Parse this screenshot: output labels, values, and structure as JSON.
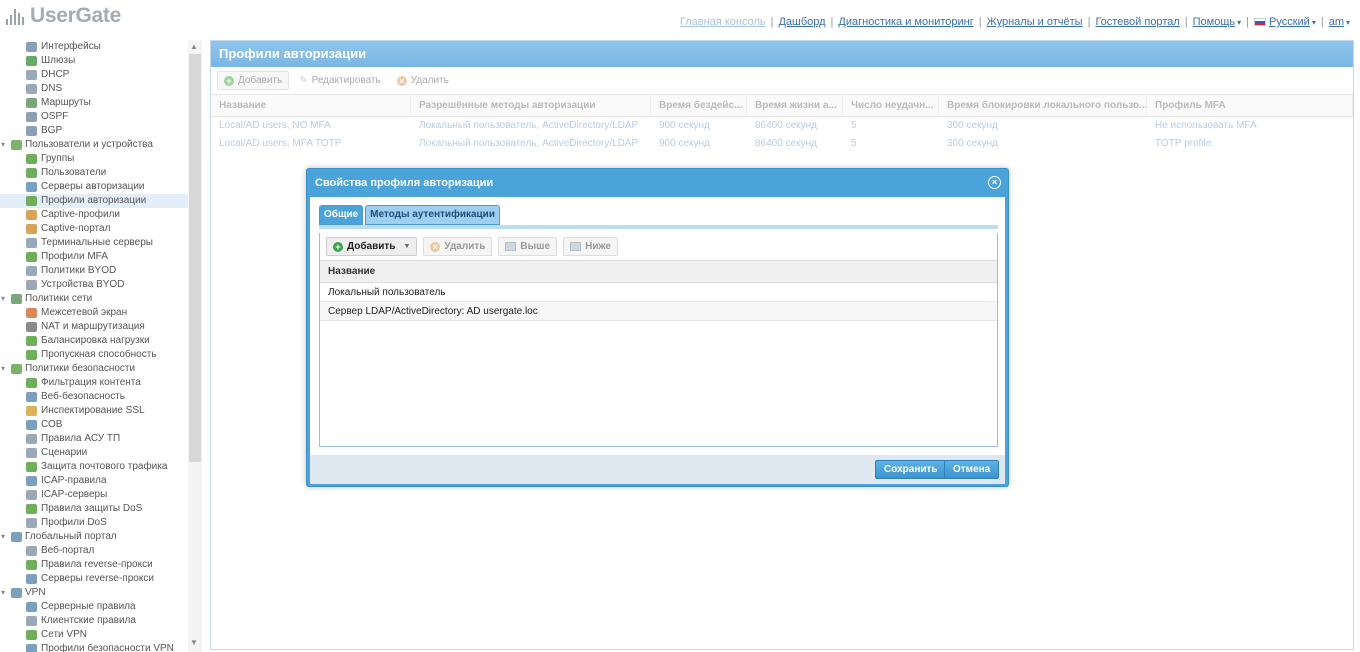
{
  "header": {
    "logo": "UserGate",
    "nav": [
      {
        "label": "Главная консоль",
        "faded": true
      },
      {
        "label": "Дашборд"
      },
      {
        "label": "Диагностика и мониторинг"
      },
      {
        "label": "Журналы и отчёты"
      },
      {
        "label": "Гостевой портал"
      },
      {
        "label": "Помощь",
        "dropdown": true
      },
      {
        "label": "Русский",
        "dropdown": true,
        "flag": true
      },
      {
        "label": "am",
        "dropdown": true
      }
    ]
  },
  "sidebar": {
    "items": [
      {
        "label": "Интерфейсы",
        "level": 1,
        "icon": "interfaces-icon",
        "color": "#8aa0b8"
      },
      {
        "label": "Шлюзы",
        "level": 1,
        "icon": "gateway-icon",
        "color": "#6aa86a"
      },
      {
        "label": "DHCP",
        "level": 1,
        "icon": "dhcp-icon",
        "color": "#9aa9b8"
      },
      {
        "label": "DNS",
        "level": 1,
        "icon": "dns-icon",
        "color": "#9aa9b8"
      },
      {
        "label": "Маршруты",
        "level": 1,
        "icon": "routes-icon",
        "color": "#7aa67a"
      },
      {
        "label": "OSPF",
        "level": 1,
        "icon": "ospf-icon",
        "color": "#8aa0b8"
      },
      {
        "label": "BGP",
        "level": 1,
        "icon": "bgp-icon",
        "color": "#8aa0b8"
      },
      {
        "label": "Пользователи и устройства",
        "level": 0,
        "icon": "users-devices-icon",
        "color": "#7db36a"
      },
      {
        "label": "Группы",
        "level": 1,
        "icon": "groups-icon",
        "color": "#6fae5a"
      },
      {
        "label": "Пользователи",
        "level": 1,
        "icon": "users-icon",
        "color": "#6fae5a"
      },
      {
        "label": "Серверы авторизации",
        "level": 1,
        "icon": "auth-servers-icon",
        "color": "#7a9fbf"
      },
      {
        "label": "Профили авторизации",
        "level": 1,
        "icon": "auth-profiles-icon",
        "color": "#6fae5a",
        "selected": true
      },
      {
        "label": "Captive-профили",
        "level": 1,
        "icon": "captive-profiles-icon",
        "color": "#d9a35a"
      },
      {
        "label": "Captive-портал",
        "level": 1,
        "icon": "captive-portal-icon",
        "color": "#d9a35a"
      },
      {
        "label": "Терминальные серверы",
        "level": 1,
        "icon": "terminal-servers-icon",
        "color": "#9aa9b8"
      },
      {
        "label": "Профили MFA",
        "level": 1,
        "icon": "mfa-profiles-icon",
        "color": "#6fae5a"
      },
      {
        "label": "Политики BYOD",
        "level": 1,
        "icon": "byod-policies-icon",
        "color": "#9aa9b8"
      },
      {
        "label": "Устройства BYOD",
        "level": 1,
        "icon": "byod-devices-icon",
        "color": "#9aa9b8"
      },
      {
        "label": "Политики сети",
        "level": 0,
        "icon": "network-policies-icon",
        "color": "#7aa67a"
      },
      {
        "label": "Межсетевой экран",
        "level": 1,
        "icon": "firewall-icon",
        "color": "#d98a5a"
      },
      {
        "label": "NAT и маршрутизация",
        "level": 1,
        "icon": "nat-icon",
        "color": "#8a8a8a"
      },
      {
        "label": "Балансировка нагрузки",
        "level": 1,
        "icon": "load-balancing-icon",
        "color": "#6fae5a"
      },
      {
        "label": "Пропускная способность",
        "level": 1,
        "icon": "bandwidth-icon",
        "color": "#6fae5a"
      },
      {
        "label": "Политики безопасности",
        "level": 0,
        "icon": "security-policies-icon",
        "color": "#7ab36a"
      },
      {
        "label": "Фильтрация контента",
        "level": 1,
        "icon": "content-filter-icon",
        "color": "#6fae5a"
      },
      {
        "label": "Веб-безопасность",
        "level": 1,
        "icon": "web-security-icon",
        "color": "#7a9fbf"
      },
      {
        "label": "Инспектирование SSL",
        "level": 1,
        "icon": "ssl-inspection-icon",
        "color": "#d9b35a"
      },
      {
        "label": "СОВ",
        "level": 1,
        "icon": "ids-icon",
        "color": "#7a9fbf"
      },
      {
        "label": "Правила АСУ ТП",
        "level": 1,
        "icon": "scada-rules-icon",
        "color": "#9aa9b8"
      },
      {
        "label": "Сценарии",
        "level": 1,
        "icon": "scenarios-icon",
        "color": "#9aa9b8"
      },
      {
        "label": "Защита почтового трафика",
        "level": 1,
        "icon": "mail-security-icon",
        "color": "#6fae5a"
      },
      {
        "label": "ICAP-правила",
        "level": 1,
        "icon": "icap-rules-icon",
        "color": "#7a9fbf"
      },
      {
        "label": "ICAP-серверы",
        "level": 1,
        "icon": "icap-servers-icon",
        "color": "#9aa9b8"
      },
      {
        "label": "Правила защиты DoS",
        "level": 1,
        "icon": "dos-rules-icon",
        "color": "#6fae5a"
      },
      {
        "label": "Профили DoS",
        "level": 1,
        "icon": "dos-profiles-icon",
        "color": "#9aa9b8"
      },
      {
        "label": "Глобальный портал",
        "level": 0,
        "icon": "global-portal-icon",
        "color": "#7a9fbf"
      },
      {
        "label": "Веб-портал",
        "level": 1,
        "icon": "web-portal-icon",
        "color": "#9aa9b8"
      },
      {
        "label": "Правила reverse-прокси",
        "level": 1,
        "icon": "reverse-proxy-rules-icon",
        "color": "#6fae5a"
      },
      {
        "label": "Серверы reverse-прокси",
        "level": 1,
        "icon": "reverse-proxy-servers-icon",
        "color": "#7a9fbf"
      },
      {
        "label": "VPN",
        "level": 0,
        "icon": "vpn-icon",
        "color": "#7a9fbf"
      },
      {
        "label": "Серверные правила",
        "level": 1,
        "icon": "server-rules-icon",
        "color": "#7a9fbf"
      },
      {
        "label": "Клиентские правила",
        "level": 1,
        "icon": "client-rules-icon",
        "color": "#9aa9b8"
      },
      {
        "label": "Сети VPN",
        "level": 1,
        "icon": "vpn-networks-icon",
        "color": "#6fae5a"
      },
      {
        "label": "Профили безопасности VPN",
        "level": 1,
        "icon": "vpn-security-profiles-icon",
        "color": "#7a9fbf"
      }
    ]
  },
  "main": {
    "title": "Профили авторизации",
    "toolbar": {
      "add": "Добавить",
      "edit": "Редактировать",
      "delete": "Удалить"
    },
    "columns": [
      {
        "label": "Название",
        "w": 200
      },
      {
        "label": "Разрешённые методы авторизации",
        "w": 240
      },
      {
        "label": "Время бездейс...",
        "w": 96
      },
      {
        "label": "Время жизни а...",
        "w": 96
      },
      {
        "label": "Число неудачн...",
        "w": 96
      },
      {
        "label": "Время блокировки локального пользо...",
        "w": 208
      },
      {
        "label": "Профиль MFA",
        "w": 206
      }
    ],
    "rows": [
      [
        "Local/AD users, NO MFA",
        "Локальный пользователь, ActiveDirectory/LDAP",
        "900 секунд",
        "86400 секунд",
        "5",
        "300 секунд",
        "Не использовать MFA"
      ],
      [
        "Local/AD users, MFA TOTP",
        "Локальный пользователь, ActiveDirectory/LDAP",
        "900 секунд",
        "86400 секунд",
        "5",
        "300 секунд",
        "TOTP profile"
      ]
    ]
  },
  "dialog": {
    "title": "Свойства профиля авторизации",
    "tabs": {
      "general": "Общие",
      "methods": "Методы аутентификации"
    },
    "toolbar": {
      "add": "Добавить",
      "delete": "Удалить",
      "up": "Выше",
      "down": "Ниже"
    },
    "column": "Название",
    "rows": [
      "Локальный пользователь",
      "Сервер LDAP/ActiveDirectory: AD usergate.loc"
    ],
    "save": "Сохранить",
    "cancel": "Отмена"
  }
}
